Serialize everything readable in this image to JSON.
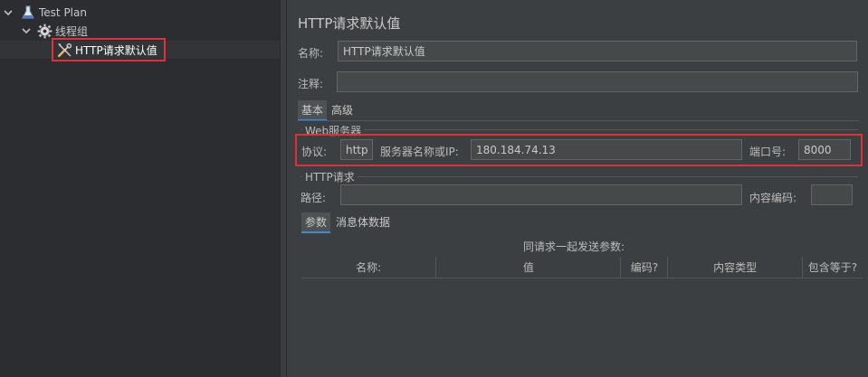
{
  "tree": {
    "items": [
      {
        "label": "Test Plan",
        "icon": "flask-icon",
        "expanded": true
      },
      {
        "label": "线程组",
        "icon": "gear-icon",
        "expanded": true
      },
      {
        "label": "HTTP请求默认值",
        "icon": "wrench-icon",
        "selected": true
      }
    ]
  },
  "form": {
    "title": "HTTP请求默认值",
    "name_label": "名称:",
    "name_value": "HTTP请求默认值",
    "comment_label": "注释:",
    "comment_value": "",
    "tabs": [
      {
        "label": "基本",
        "active": true
      },
      {
        "label": "高级",
        "active": false
      }
    ],
    "web_server": {
      "group_title": "Web服务器",
      "protocol_label": "协议:",
      "protocol_value": "http",
      "server_label": "服务器名称或IP:",
      "server_value": "180.184.74.13",
      "port_label": "端口号:",
      "port_value": "8000"
    },
    "http_request": {
      "group_title": "HTTP请求",
      "path_label": "路径:",
      "path_value": "",
      "encoding_label": "内容编码:",
      "encoding_value": ""
    },
    "sub_tabs": [
      {
        "label": "参数",
        "active": true
      },
      {
        "label": "消息体数据",
        "active": false
      }
    ],
    "params_caption": "同请求一起发送参数:",
    "table_columns": [
      "名称:",
      "值",
      "编码?",
      "内容类型",
      "包含等于?"
    ]
  },
  "colors": {
    "highlight_border": "#e0303a",
    "tab_accent": "#4a88c7",
    "background": "#3c3f41",
    "tree_background": "#2b2d30"
  }
}
